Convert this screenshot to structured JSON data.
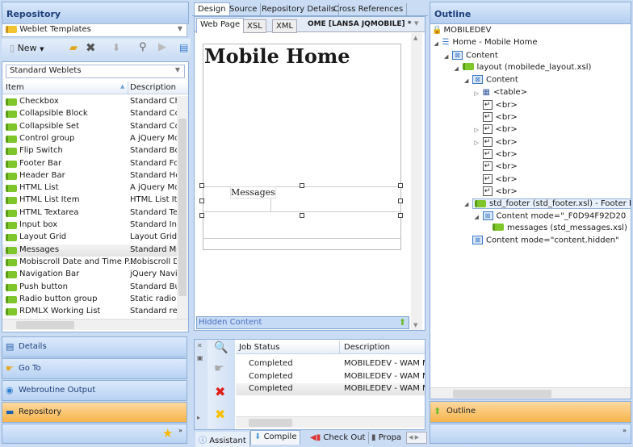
{
  "left": {
    "title": "Repository",
    "template_combo": "Weblet Templates",
    "toolbar": {
      "new_label": "New"
    },
    "weblet_combo": "Standard Weblets",
    "columns": [
      "Item",
      "Description"
    ],
    "items": [
      {
        "item": "Checkbox",
        "desc": "Standard Ch"
      },
      {
        "item": "Collapsible Block",
        "desc": "Standard Co"
      },
      {
        "item": "Collapsible Set",
        "desc": "Standard Co"
      },
      {
        "item": "Control group",
        "desc": "A jQuery Mo"
      },
      {
        "item": "Flip Switch",
        "desc": "Standard Bo"
      },
      {
        "item": "Footer Bar",
        "desc": "Standard Fo"
      },
      {
        "item": "Header Bar",
        "desc": "Standard He"
      },
      {
        "item": "HTML List",
        "desc": "A jQuery Mo"
      },
      {
        "item": "HTML List Item",
        "desc": "HTML List It"
      },
      {
        "item": "HTML Textarea",
        "desc": "Standard Tex"
      },
      {
        "item": "Input box",
        "desc": "Standard Inp"
      },
      {
        "item": "Layout Grid",
        "desc": "Layout Grid"
      },
      {
        "item": "Messages",
        "desc": "Standard Me",
        "selected": true
      },
      {
        "item": "Mobiscroll Date and Time P...",
        "desc": "Mobiscroll D"
      },
      {
        "item": "Navigation Bar",
        "desc": "jQuery Navig"
      },
      {
        "item": "Push button",
        "desc": "Standard Bu"
      },
      {
        "item": "Radio button group",
        "desc": "Static radio b"
      },
      {
        "item": "RDMLX Working List",
        "desc": "Standard rep"
      }
    ],
    "nav": [
      {
        "label": "Details",
        "icon": "details-icon"
      },
      {
        "label": "Go To",
        "icon": "pointing-hand-icon"
      },
      {
        "label": "Webroutine Output",
        "icon": "globe-icon"
      },
      {
        "label": "Repository",
        "icon": "monitor-icon",
        "active": true
      }
    ]
  },
  "center": {
    "tabs": [
      "Design",
      "Source",
      "Repository Details",
      "Cross References"
    ],
    "inner_tabs": [
      "Web Page",
      "XSL",
      "XML"
    ],
    "doc_title": "OME [LANSA JQMOBILE] *",
    "page_heading": "Mobile Home",
    "messages_label": "Messages",
    "hidden_content": "Hidden Content",
    "jobs": {
      "columns": [
        "Job Status",
        "Description"
      ],
      "rows": [
        {
          "status": "Completed",
          "desc": "MOBILEDEV - WAM M"
        },
        {
          "status": "Completed",
          "desc": "MOBILEDEV - WAM M"
        },
        {
          "status": "Completed",
          "desc": "MOBILEDEV - WAM M",
          "selected": true
        }
      ]
    },
    "bottom_tabs": [
      "Assistant",
      "Compile",
      "Check Out",
      "Propa"
    ]
  },
  "right": {
    "title": "Outline",
    "tree": [
      {
        "label": "MOBILEDEV",
        "level": 0,
        "icon": "lock-icon"
      },
      {
        "label": "Home - Mobile Home",
        "level": 1,
        "icon": "page-icon",
        "exp": "open"
      },
      {
        "label": "Content",
        "level": 2,
        "icon": "content-icon",
        "exp": "open"
      },
      {
        "label": "layout (mobilede_layout.xsl)",
        "level": 3,
        "icon": "weblet-icon",
        "exp": "open"
      },
      {
        "label": "Content",
        "level": 4,
        "icon": "content-icon",
        "exp": "open"
      },
      {
        "label": "<table>",
        "level": 5,
        "icon": "table-icon",
        "exp": "closed"
      },
      {
        "label": "<br>",
        "level": 5,
        "icon": "br-icon"
      },
      {
        "label": "<br>",
        "level": 5,
        "icon": "br-icon"
      },
      {
        "label": "<br>",
        "level": 5,
        "icon": "br-icon",
        "exp": "closed"
      },
      {
        "label": "<br>",
        "level": 5,
        "icon": "br-icon",
        "exp": "closed"
      },
      {
        "label": "<br>",
        "level": 5,
        "icon": "br-icon"
      },
      {
        "label": "<br>",
        "level": 5,
        "icon": "br-icon"
      },
      {
        "label": "<br>",
        "level": 5,
        "icon": "br-icon"
      },
      {
        "label": "<br>",
        "level": 5,
        "icon": "br-icon"
      },
      {
        "label": "std_footer (std_footer.xsl) - Footer B",
        "level": 4,
        "icon": "weblet-icon",
        "exp": "open",
        "selected": true
      },
      {
        "label": "Content mode=\"_F0D94F92D20",
        "level": 5,
        "icon": "content-icon",
        "exp": "open"
      },
      {
        "label": "messages (std_messages.xsl)",
        "level": 6,
        "icon": "weblet-icon"
      },
      {
        "label": "Content mode=\"content.hidden\"",
        "level": 4,
        "icon": "content-icon"
      }
    ],
    "footer_label": "Outline"
  }
}
